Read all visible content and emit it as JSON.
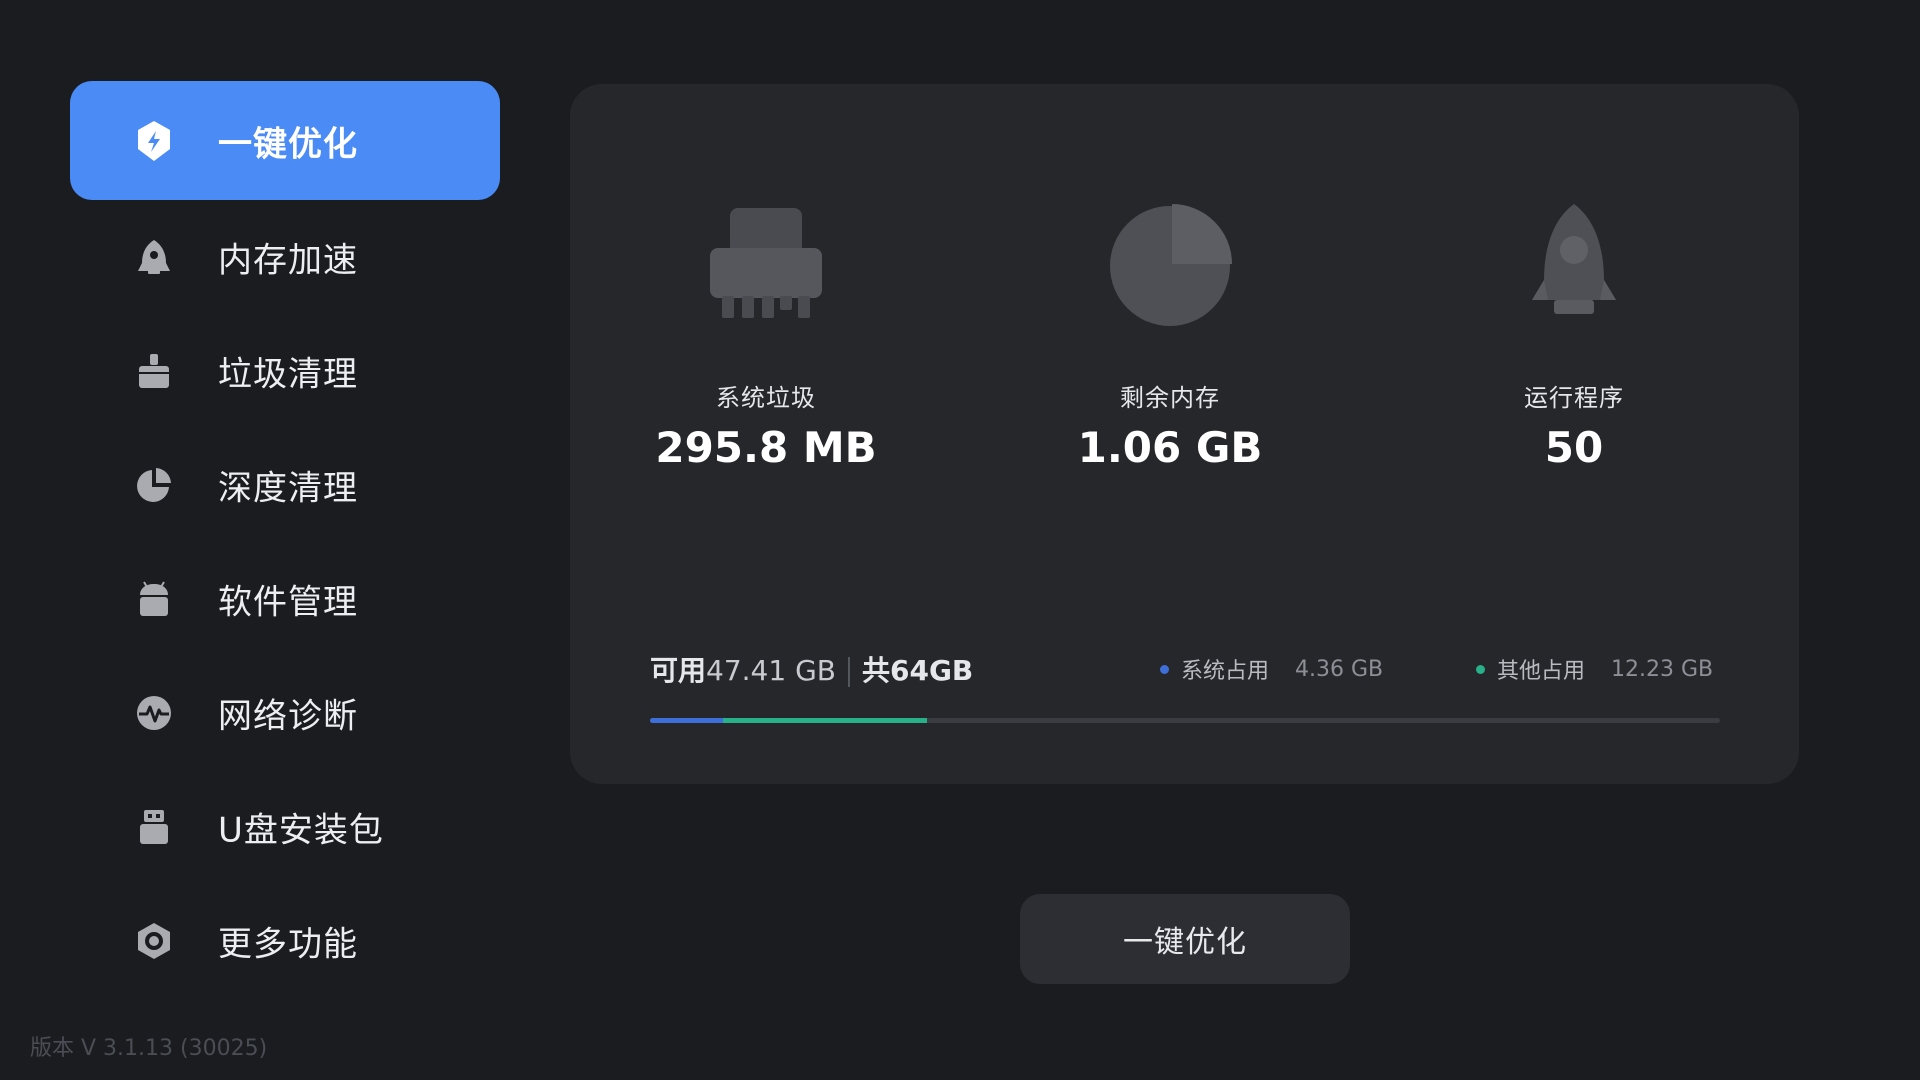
{
  "colors": {
    "accent": "#4b8bf5",
    "system_usage": "#3e6fd8",
    "other_usage": "#27b08a"
  },
  "sidebar": {
    "items": [
      {
        "label": "一键优化",
        "icon": "shield-bolt-icon",
        "active": true
      },
      {
        "label": "内存加速",
        "icon": "rocket-icon",
        "active": false
      },
      {
        "label": "垃圾清理",
        "icon": "broom-icon",
        "active": false
      },
      {
        "label": "深度清理",
        "icon": "pie-chart-icon",
        "active": false
      },
      {
        "label": "软件管理",
        "icon": "android-icon",
        "active": false
      },
      {
        "label": "网络诊断",
        "icon": "pulse-icon",
        "active": false
      },
      {
        "label": "U盘安装包",
        "icon": "usb-icon",
        "active": false
      },
      {
        "label": "更多功能",
        "icon": "hexagon-gear-icon",
        "active": false
      }
    ],
    "version": "版本 V 3.1.13 (30025)"
  },
  "stats": [
    {
      "label": "系统垃圾",
      "value": "295.8 MB",
      "icon": "shredder-icon"
    },
    {
      "label": "剩余内存",
      "value": "1.06 GB",
      "icon": "pie-chart-icon"
    },
    {
      "label": "运行程序",
      "value": "50",
      "icon": "rocket-icon"
    }
  ],
  "storage": {
    "available_label": "可用",
    "available_value": "47.41 GB",
    "total": "共64GB",
    "legend": [
      {
        "name": "系统占用",
        "value": "4.36 GB"
      },
      {
        "name": "其他占用",
        "value": "12.23 GB"
      }
    ],
    "system_fraction": 0.068,
    "other_fraction": 0.191
  },
  "action": {
    "optimize_label": "一键优化"
  }
}
